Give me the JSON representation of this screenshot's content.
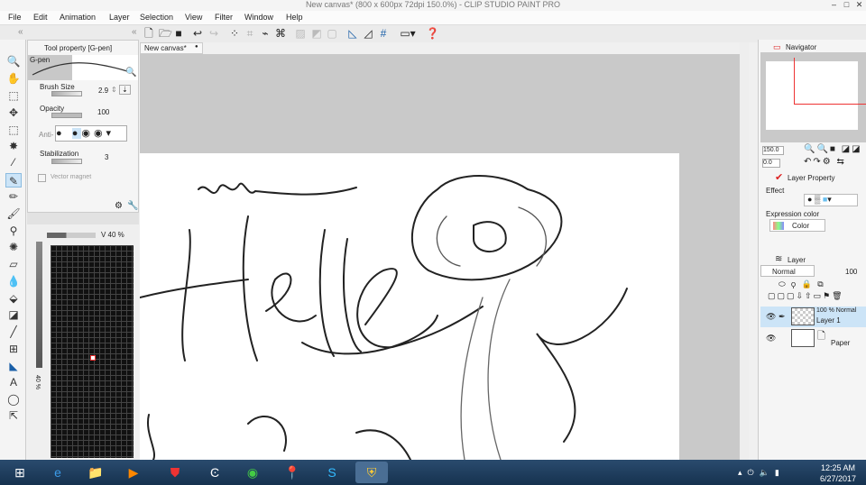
{
  "window": {
    "title": "New canvas* (800 x 600px 72dpi 150.0%) - CLIP STUDIO PAINT PRO",
    "minimize": "–",
    "maximize": "□",
    "close": "✕"
  },
  "menu": [
    "File",
    "Edit",
    "Animation",
    "Layer",
    "Selection",
    "View",
    "Filter",
    "Window",
    "Help"
  ],
  "canvas_tab": {
    "label": "New canvas*",
    "dot": "●"
  },
  "tool_property": {
    "header": "Tool property [G-pen]",
    "brush_name": "G-pen",
    "brush_size_label": "Brush Size",
    "brush_size": "2.9",
    "opacity_label": "Opacity",
    "opacity": "100",
    "anti_label": "Anti-",
    "stabilization_label": "Stabilization",
    "stabilization": "3",
    "vector_magnet_label": "Vector magnet"
  },
  "color": {
    "v_label": "V 40 %",
    "side_value": "40 %",
    "v_percent": 40
  },
  "navigator": {
    "tab": "Navigator",
    "zoom": "150.0",
    "rotation": "0.0"
  },
  "layer_property": {
    "tab": "Layer Property",
    "effect_label": "Effect",
    "expression_label": "Expression color",
    "expression_value": "Color"
  },
  "layers": {
    "tab": "Layer",
    "blend_mode": "Normal",
    "opacity": "100",
    "items": [
      {
        "top": "100 %  Normal",
        "name": "Layer 1"
      },
      {
        "top": "",
        "name": "Paper"
      }
    ]
  },
  "taskbar": {
    "time": "12:25 AM",
    "date": "6/27/2017"
  },
  "colors": {
    "taskbar": "#1e3d5e",
    "canvas_bg": "#c9c9c9",
    "selection": "#cce4f7"
  }
}
